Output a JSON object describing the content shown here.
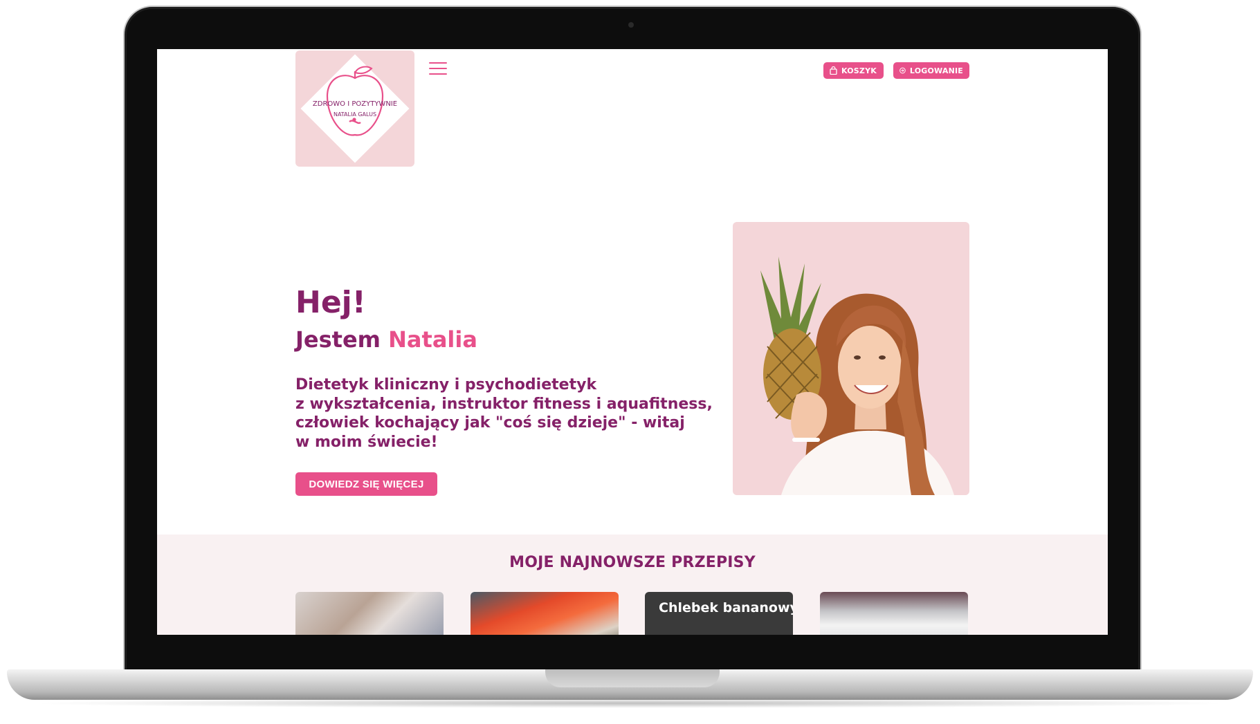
{
  "header": {
    "logo": {
      "title_text": "ZDROWO I POZYTYWNIE",
      "subtitle_text": "NATALIA GALUS"
    },
    "cart_label": "KOSZYK",
    "login_label": "LOGOWANIE"
  },
  "hero": {
    "greeting": "Hej!",
    "name_prefix": "Jestem",
    "name_highlight": "Natalia",
    "description_lines": [
      "Dietetyk kliniczny i psychodietetyk",
      "z wykształcenia, instruktor fitness i aquafitness,",
      "człowiek kochający jak \"coś się dzieje\" - witaj",
      "w moim świecie!"
    ],
    "cta_label": "DOWIEDZ SIĘ WIĘCEJ"
  },
  "recipes": {
    "title": "MOJE NAJNOWSZE PRZEPISY",
    "cards": [
      {
        "title": ""
      },
      {
        "title": ""
      },
      {
        "title": "Chlebek bananowy"
      },
      {
        "title": ""
      }
    ]
  },
  "colors": {
    "primary_pink": "#e8508a",
    "plum": "#852168",
    "soft_pink": "#f4d6d9",
    "section_bg": "#f9f1f2"
  },
  "icons": [
    "menu-icon",
    "shopping-bag-icon",
    "login-icon"
  ]
}
